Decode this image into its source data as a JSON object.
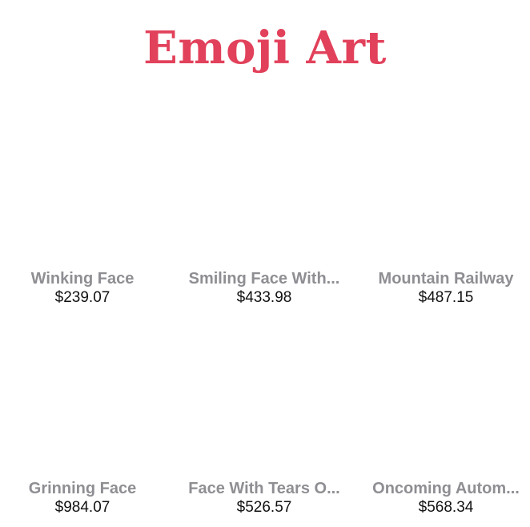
{
  "header": {
    "title": "Emoji Art"
  },
  "products": [
    {
      "name": "Winking Face",
      "price": "$239.07"
    },
    {
      "name": "Smiling Face With...",
      "price": "$433.98"
    },
    {
      "name": "Mountain Railway",
      "price": "$487.15"
    },
    {
      "name": "Grinning Face",
      "price": "$984.07"
    },
    {
      "name": "Face With Tears O...",
      "price": "$526.57"
    },
    {
      "name": "Oncoming Autom...",
      "price": "$568.34"
    }
  ],
  "colors": {
    "title": "#e2415b",
    "product_name": "#8e8e93",
    "price": "#111111",
    "background": "#ffffff"
  }
}
